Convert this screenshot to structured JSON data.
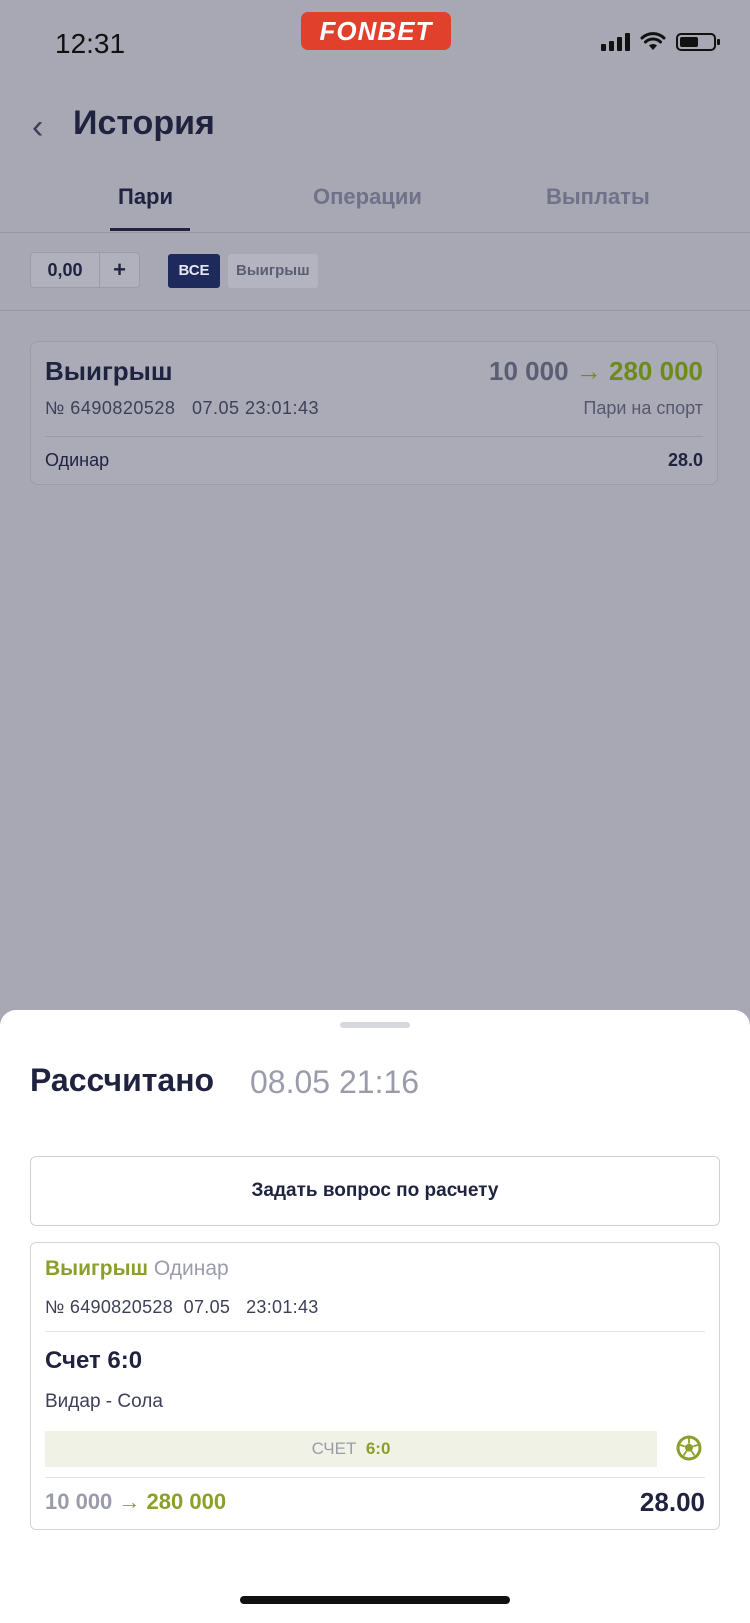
{
  "status_bar": {
    "time": "12:31",
    "brand": "FONBET"
  },
  "header": {
    "title": "История"
  },
  "tabs": [
    {
      "label": "Пари",
      "active": true
    },
    {
      "label": "Операции",
      "active": false
    },
    {
      "label": "Выплаты",
      "active": false
    }
  ],
  "filters": {
    "amount_value": "0,00",
    "plus_label": "+",
    "chips": [
      {
        "label": "ВСЕ",
        "active": true
      },
      {
        "label": "Выигрыш",
        "active": false
      }
    ]
  },
  "bet_card": {
    "status": "Выигрыш",
    "stake": "10 000",
    "arrow": "→",
    "payout": "280 000",
    "number": "№ 6490820528",
    "datetime": "07.05 23:01:43",
    "category": "Пари на спорт",
    "bet_type": "Одинар",
    "coefficient": "28.0"
  },
  "sheet": {
    "title": "Рассчитано",
    "settled_at": "08.05 21:16",
    "ask_button": "Задать вопрос по расчету",
    "detail": {
      "status": "Выигрыш",
      "bet_type": "Одинар",
      "number": "№ 6490820528",
      "date": "07.05",
      "time": "23:01:43",
      "market": "Счет 6:0",
      "match": "Видар - Сола",
      "result_label": "СЧЕТ",
      "result_value": "6:0",
      "stake": "10 000",
      "arrow": "→",
      "payout": "280 000",
      "coefficient": "28.00"
    }
  },
  "colors": {
    "accent_green": "#8aa02a",
    "brand_red": "#e0402c",
    "navy": "#1f2340"
  }
}
